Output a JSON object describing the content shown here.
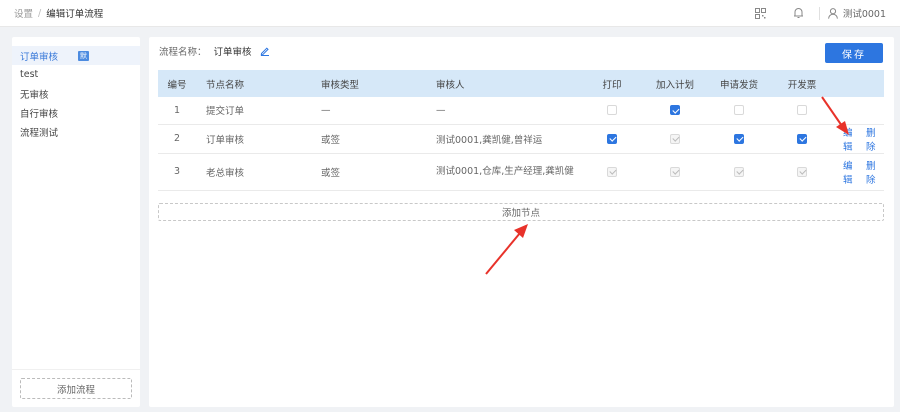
{
  "breadcrumb": {
    "parent": "设置",
    "separator": "/",
    "current": "编辑订单流程"
  },
  "header": {
    "user_name": "测试0001"
  },
  "sidebar": {
    "items": [
      {
        "label": "订单审核",
        "badge": "默",
        "active": true
      },
      {
        "label": "test"
      },
      {
        "label": "无审核"
      },
      {
        "label": "自行审核"
      },
      {
        "label": "流程测试"
      }
    ],
    "add_button": "添加流程"
  },
  "main": {
    "flow_name_label": "流程名称：",
    "flow_name_value": "订单审核",
    "save_button": "保存",
    "columns": [
      "编号",
      "节点名称",
      "审核类型",
      "审核人",
      "打印",
      "加入计划",
      "申请发货",
      "开发票"
    ],
    "rows": [
      {
        "no": "1",
        "name": "提交订单",
        "type": "—",
        "reviewer": "—",
        "checks": [
          "off",
          "on",
          "off",
          "off"
        ],
        "ops": []
      },
      {
        "no": "2",
        "name": "订单审核",
        "type": "或签",
        "reviewer": "测试0001,龚凯健,曾祥运",
        "checks": [
          "on",
          "dis",
          "on",
          "on"
        ],
        "ops": [
          "编辑",
          "删除"
        ]
      },
      {
        "no": "3",
        "name": "老总审核",
        "type": "或签",
        "reviewer": "测试0001,仓库,生产经理,龚凯健",
        "checks": [
          "dis",
          "dis",
          "dis",
          "dis"
        ],
        "ops": [
          "编辑",
          "删除"
        ]
      }
    ],
    "add_node_button": "添加节点"
  },
  "colors": {
    "accent": "#2d76e0",
    "table_header": "#d6e8f8",
    "arrow": "#e8322a"
  }
}
